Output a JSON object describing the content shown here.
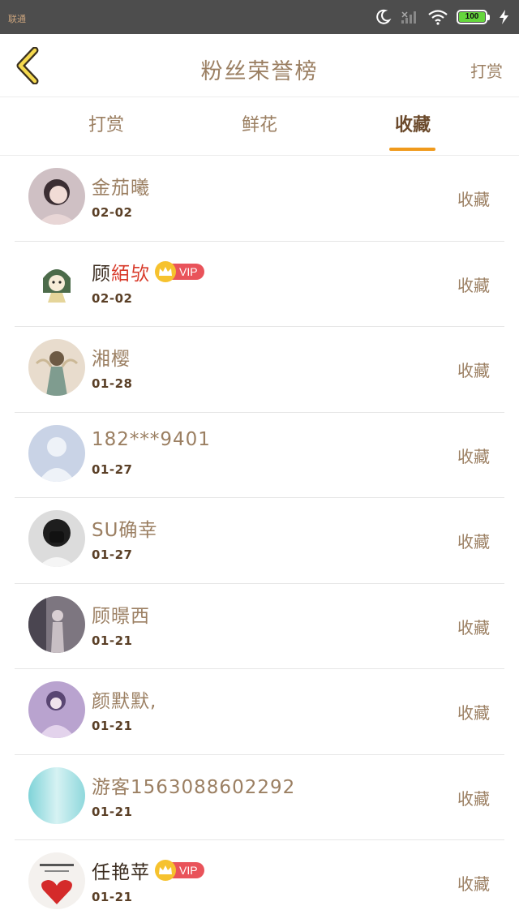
{
  "status_bar": {
    "carrier": "联通",
    "battery": "100"
  },
  "header": {
    "title": "粉丝荣誉榜",
    "action": "打赏"
  },
  "tabs": [
    {
      "label": "打赏"
    },
    {
      "label": "鲜花"
    },
    {
      "label": "收藏",
      "active": true
    }
  ],
  "colors": {
    "accent": "#f09a1c",
    "text": "#9b7f62",
    "vip": "#e9535a",
    "crown": "#f6c22e"
  },
  "rows": [
    {
      "name": "金茄曦",
      "date": "02-02",
      "action": "收藏",
      "vip": false,
      "avatar_icon": "girl-portrait-avatar"
    },
    {
      "name_prefix": "顾",
      "name_highlight": "絔欤",
      "date": "02-02",
      "action": "收藏",
      "vip": true,
      "vip_label": "VIP",
      "avatar_icon": "cartoon-girl-avatar"
    },
    {
      "name": "湘樱",
      "date": "01-28",
      "action": "收藏",
      "vip": false,
      "avatar_icon": "fairy-avatar"
    },
    {
      "name": "182***9401",
      "date": "01-27",
      "action": "收藏",
      "vip": false,
      "avatar_icon": "default-user-avatar"
    },
    {
      "name": "SU确幸",
      "date": "01-27",
      "action": "收藏",
      "vip": false,
      "avatar_icon": "masked-person-avatar"
    },
    {
      "name": "顾暻西",
      "date": "01-21",
      "action": "收藏",
      "vip": false,
      "avatar_icon": "dark-photo-avatar"
    },
    {
      "name": "颜默默,",
      "date": "01-21",
      "action": "收藏",
      "vip": false,
      "avatar_icon": "purple-girl-avatar"
    },
    {
      "name": "游客1563088602292",
      "date": "01-21",
      "action": "收藏",
      "vip": false,
      "avatar_icon": "cyan-gradient-avatar"
    },
    {
      "name": "任艳苹",
      "date": "01-21",
      "action": "收藏",
      "vip": true,
      "vip_label": "VIP",
      "avatar_icon": "roses-heart-avatar"
    }
  ]
}
